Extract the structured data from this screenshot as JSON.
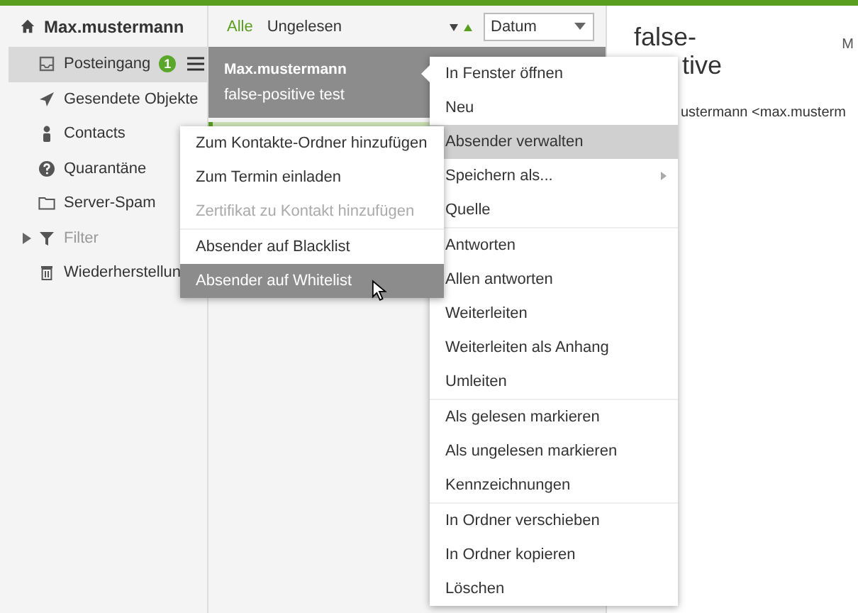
{
  "sidebar": {
    "account": "Max.mustermann",
    "folders": [
      {
        "label": "Posteingang",
        "kind": "inbox",
        "selected": true,
        "disabled": false,
        "badge": "1"
      },
      {
        "label": "Gesendete Objekte",
        "kind": "sent",
        "selected": false,
        "disabled": false
      },
      {
        "label": "Contacts",
        "kind": "contacts",
        "selected": false,
        "disabled": false
      },
      {
        "label": "Quarantäne",
        "kind": "quarantine",
        "selected": false,
        "disabled": false
      },
      {
        "label": "Server-Spam",
        "kind": "folder",
        "selected": false,
        "disabled": false
      },
      {
        "label": "Filter",
        "kind": "filter",
        "selected": false,
        "disabled": true
      },
      {
        "label": "Wiederherstellun",
        "kind": "trash",
        "selected": false,
        "disabled": false
      }
    ]
  },
  "list": {
    "filters": [
      {
        "label": "Alle",
        "selected": true
      },
      {
        "label": "Ungelesen",
        "selected": false
      }
    ],
    "sort": {
      "value": "Datum"
    },
    "messages": [
      {
        "sender": "Max.mustermann",
        "subject": "false-positive test",
        "selected": true
      }
    ]
  },
  "reading": {
    "subject_lines": [
      "false-",
      "tive"
    ],
    "date": "M",
    "from": "ustermann <max.musterm"
  },
  "context_menu": {
    "groups": [
      [
        {
          "label": "In Fenster öffnen",
          "selected": false,
          "disabled": false,
          "submenu": false
        },
        {
          "label": "Neu",
          "selected": false,
          "disabled": false,
          "submenu": false
        },
        {
          "label": "Absender verwalten",
          "selected": true,
          "disabled": false,
          "submenu": false
        },
        {
          "label": "Speichern als...",
          "selected": false,
          "disabled": false,
          "submenu": true
        },
        {
          "label": "Quelle",
          "selected": false,
          "disabled": false,
          "submenu": false
        }
      ],
      [
        {
          "label": "Antworten",
          "selected": false,
          "disabled": false,
          "submenu": false
        },
        {
          "label": "Allen antworten",
          "selected": false,
          "disabled": false,
          "submenu": false
        },
        {
          "label": "Weiterleiten",
          "selected": false,
          "disabled": false,
          "submenu": false
        },
        {
          "label": "Weiterleiten als Anhang",
          "selected": false,
          "disabled": false,
          "submenu": false
        },
        {
          "label": "Umleiten",
          "selected": false,
          "disabled": false,
          "submenu": false
        }
      ],
      [
        {
          "label": "Als gelesen markieren",
          "selected": false,
          "disabled": false,
          "submenu": false
        },
        {
          "label": "Als ungelesen markieren",
          "selected": false,
          "disabled": false,
          "submenu": false
        },
        {
          "label": "Kennzeichnungen",
          "selected": false,
          "disabled": false,
          "submenu": false
        }
      ],
      [
        {
          "label": "In Ordner verschieben",
          "selected": false,
          "disabled": false,
          "submenu": false
        },
        {
          "label": "In Ordner kopieren",
          "selected": false,
          "disabled": false,
          "submenu": false
        },
        {
          "label": "Löschen",
          "selected": false,
          "disabled": false,
          "submenu": false
        }
      ]
    ]
  },
  "submenu": {
    "groups": [
      [
        {
          "label": "Zum Kontakte-Ordner hinzufügen",
          "selected": false,
          "disabled": false
        },
        {
          "label": "Zum Termin einladen",
          "selected": false,
          "disabled": false
        },
        {
          "label": "Zertifikat zu Kontakt hinzufügen",
          "selected": false,
          "disabled": true
        }
      ],
      [
        {
          "label": "Absender auf Blacklist",
          "selected": false,
          "disabled": false
        },
        {
          "label": "Absender auf Whitelist",
          "selected": true,
          "disabled": false
        }
      ]
    ]
  }
}
